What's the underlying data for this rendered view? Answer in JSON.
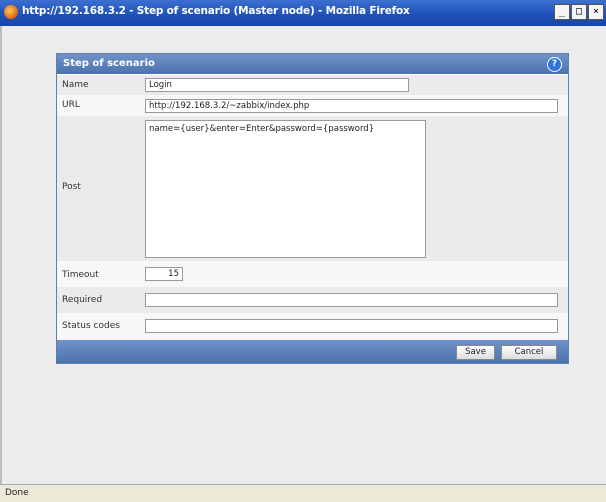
{
  "window": {
    "title": "http://192.168.3.2 - Step of scenario (Master node) - Mozilla Firefox",
    "minimize": "_",
    "maximize": "□",
    "close": "×"
  },
  "form": {
    "title": "Step of scenario",
    "help": "?",
    "fields": {
      "name": {
        "label": "Name",
        "value": "Login"
      },
      "url": {
        "label": "URL",
        "value": "http://192.168.3.2/~zabbix/index.php"
      },
      "post": {
        "label": "Post",
        "value": "name={user}&enter=Enter&password={password}"
      },
      "timeout": {
        "label": "Timeout",
        "value": "15"
      },
      "required": {
        "label": "Required",
        "value": ""
      },
      "status_codes": {
        "label": "Status codes",
        "value": ""
      }
    },
    "buttons": {
      "save": "Save",
      "cancel": "Cancel"
    }
  },
  "statusbar": {
    "text": "Done"
  },
  "colors": {
    "header": "#5b7fb9",
    "titlebar": "#2458c0"
  }
}
